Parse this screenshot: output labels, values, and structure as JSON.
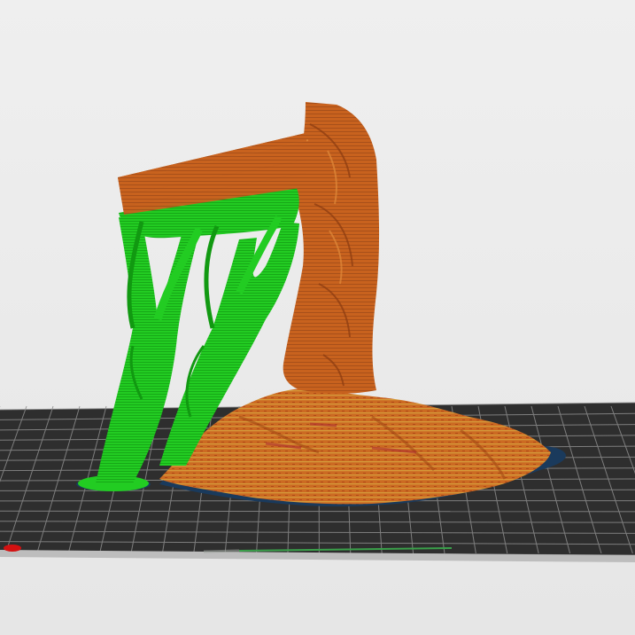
{
  "app": {
    "view": "slicer-preview-3d"
  },
  "scene": {
    "object": "tree-model",
    "support_type": "tree-supports",
    "colors": {
      "background": "#ececec",
      "bed_plate": "#2e2e2e",
      "bed_grid": "#8c8c8c",
      "model_wall": "#c8621e",
      "model_highlight": "#e08a3a",
      "model_infill_accent": "#c4a030",
      "support": "#22cc22",
      "support_shadow": "#119911",
      "brim": "#1a3a5c",
      "origin_marker": "#d41111",
      "travel_marker": "#3aa04a"
    }
  }
}
